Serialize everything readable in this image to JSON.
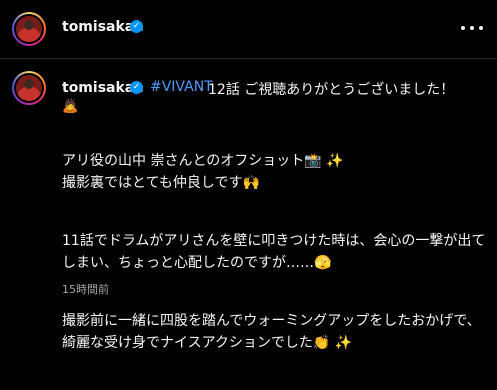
{
  "header": {
    "username": "tomisakae",
    "verified_mark": "✓",
    "more_icon": "more-horizontal-icon"
  },
  "caption": {
    "username": "tomisakae",
    "verified_mark": "✓",
    "hashtag": "#VIVANT",
    "first_line": "12話 ご視聴ありがとうございました！",
    "first_line_emoji": "🙇",
    "paragraphs": [
      "アリ役の山中 崇さんとのオフショット📸 ✨\n撮影裏ではとても仲良しです🙌",
      "11話でドラムがアリさんを壁に叩きつけた時は、会心の一撃が出てしまい、ちょっと心配したのですが……🫣",
      "撮影前に一緒に四股を踏んでウォーミングアップをしたおかげで、綺麗な受け身でナイスアクションでした👏 ✨"
    ],
    "timestamp": "15時間前"
  },
  "colors": {
    "background": "#000000",
    "text": "#f5f5f5",
    "hashtag": "#4d9aff",
    "verified": "#0095f6",
    "muted": "#a8a8a8"
  }
}
